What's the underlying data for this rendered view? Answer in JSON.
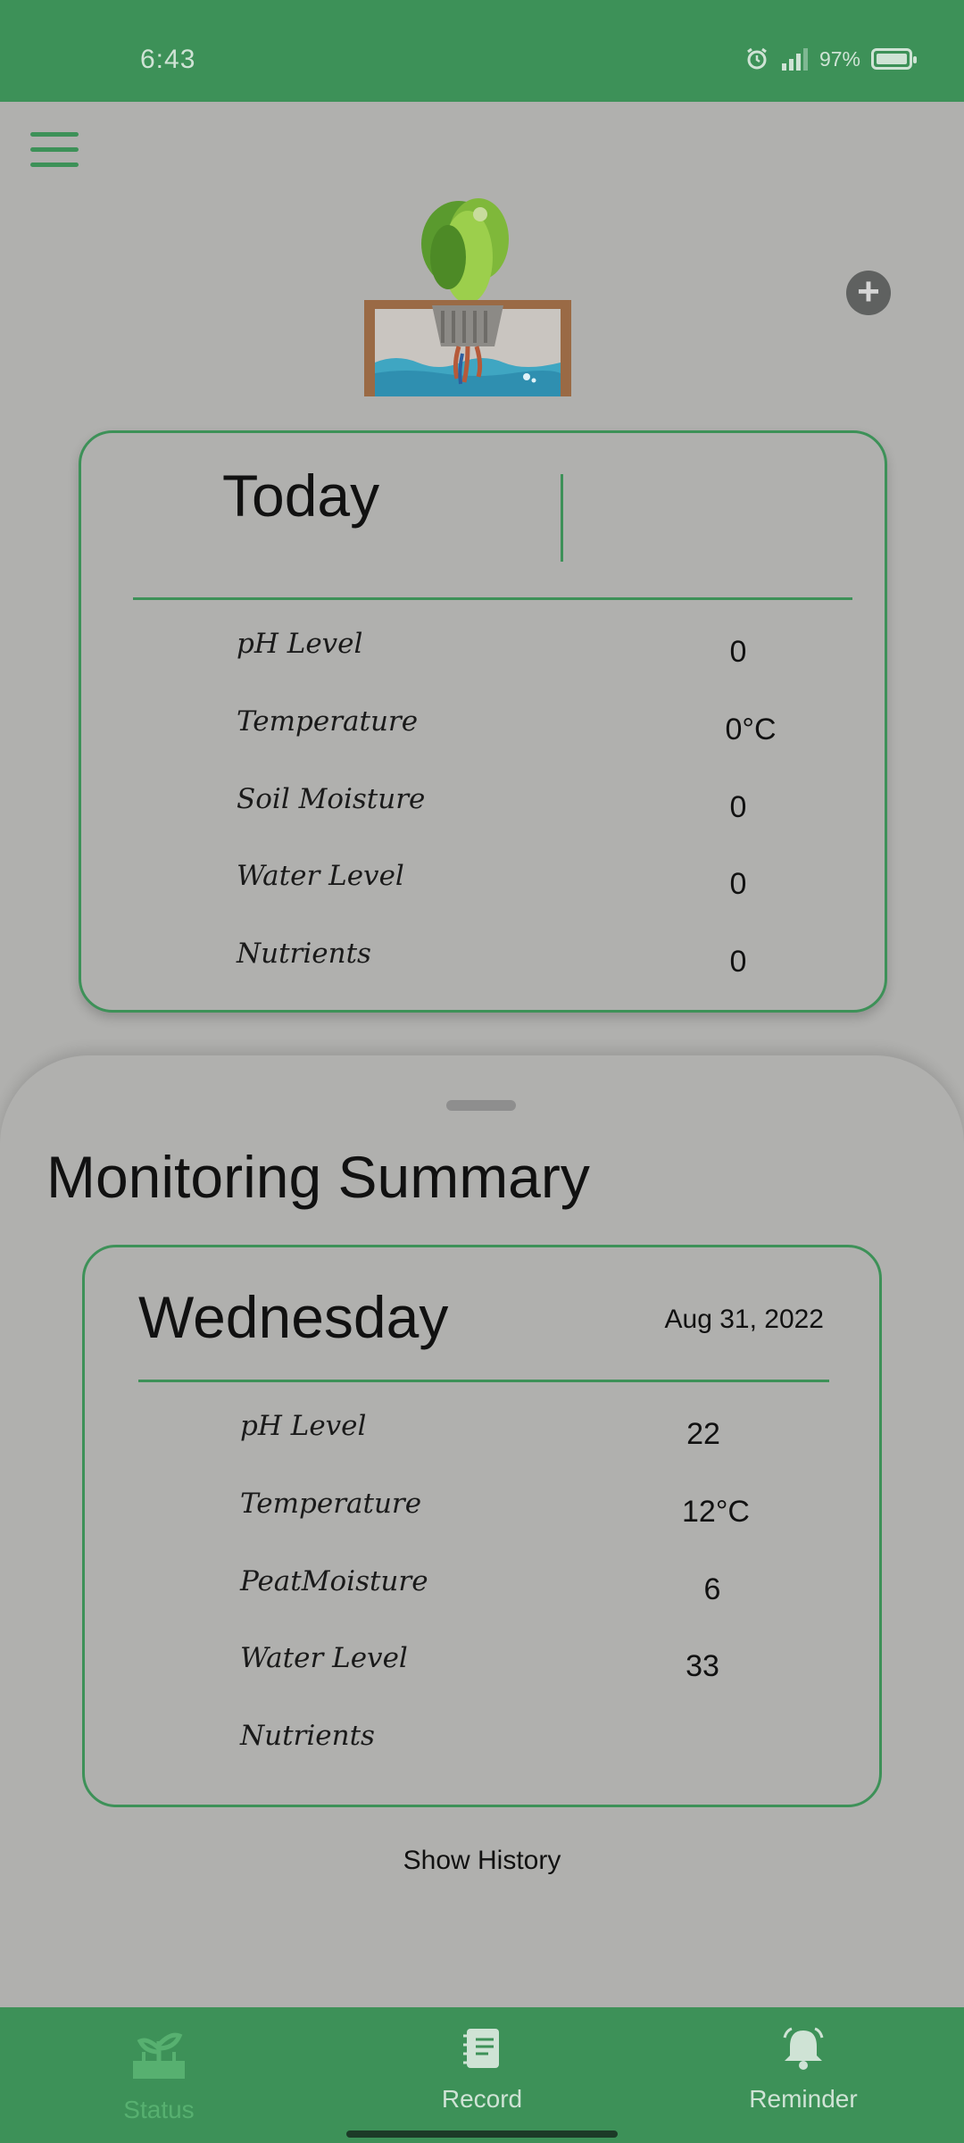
{
  "status_bar": {
    "time": "6:43",
    "battery": "97%"
  },
  "today": {
    "title": "Today",
    "rows": [
      {
        "label": "pH Level",
        "value": "0"
      },
      {
        "label": "Temperature",
        "value": "0°C"
      },
      {
        "label": "Soil Moisture",
        "value": "0"
      },
      {
        "label": "Water Level",
        "value": "0"
      },
      {
        "label": "Nutrients",
        "value": "0"
      }
    ]
  },
  "summary": {
    "title": "Monitoring Summary",
    "day": "Wednesday",
    "date": "Aug 31, 2022",
    "rows": [
      {
        "label": "pH Level",
        "value": "22"
      },
      {
        "label": "Temperature",
        "value": "12°C"
      },
      {
        "label": "PeatMoisture",
        "value": "6"
      },
      {
        "label": "Water Level",
        "value": "33"
      },
      {
        "label": "Nutrients",
        "value": ""
      }
    ],
    "show_history": "Show History"
  },
  "nav": [
    {
      "label": "Status",
      "icon": "plant-icon",
      "active": true
    },
    {
      "label": "Record",
      "icon": "notebook-icon",
      "active": false
    },
    {
      "label": "Reminder",
      "icon": "bell-icon",
      "active": false
    }
  ],
  "colors": {
    "primary": "#3d9158",
    "background": "#b0b0ae"
  }
}
